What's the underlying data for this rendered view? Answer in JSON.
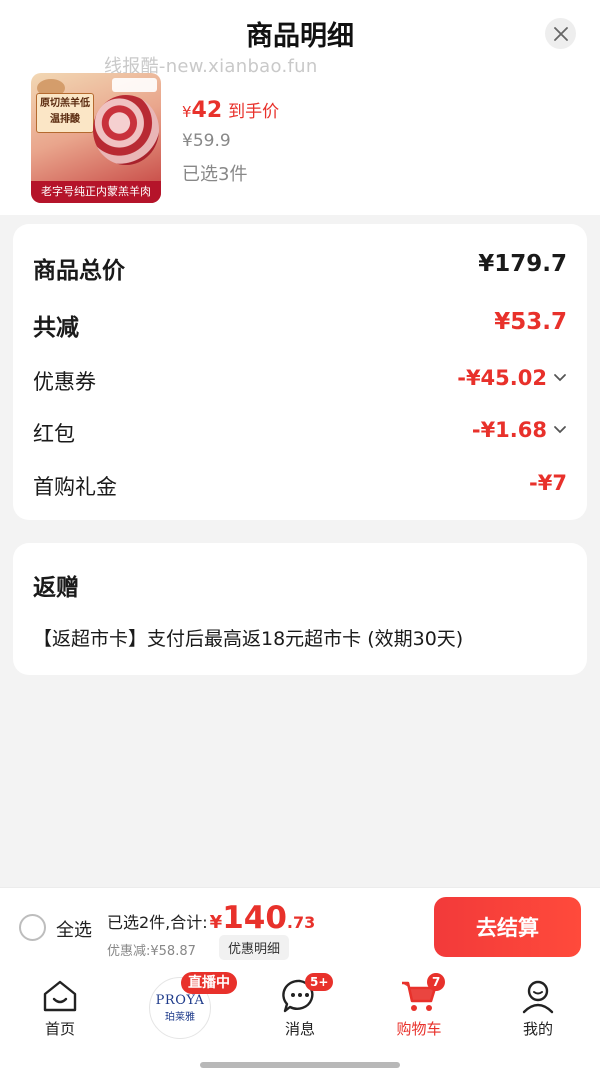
{
  "header": {
    "title": "商品明细",
    "watermark": "线报酷-new.xianbao.fun"
  },
  "product": {
    "badge_text": "原切羔羊低温排酸",
    "caption": "老字号纯正内蒙羔羊肉",
    "currency": "¥",
    "final_price": "42",
    "final_price_label": "到手价",
    "original_price": "¥59.9",
    "selected_count": "已选3件"
  },
  "summary": {
    "total_label": "商品总价",
    "total_value": "¥179.7",
    "reduce_label": "共减",
    "reduce_value": "¥53.7",
    "lines": [
      {
        "label": "优惠券",
        "value": "-¥45.02"
      },
      {
        "label": "红包",
        "value": "-¥1.68"
      },
      {
        "label": "首购礼金",
        "value": "-¥7"
      }
    ]
  },
  "gift": {
    "title": "返赠",
    "text": "【返超市卡】支付后最高返18元超市卡 (效期30天)"
  },
  "checkout_bar": {
    "select_all": "全选",
    "selected_total_prefix": "已选2件,合计:",
    "currency": "¥",
    "total_integer": "140",
    "total_decimal": ".73",
    "discount_text": "优惠减:¥58.87",
    "detail_button": "优惠明细",
    "checkout_button": "去结算"
  },
  "tabbar": {
    "home": "首页",
    "live_badge": "直播中",
    "live_brand": "PROYA",
    "live_brand_sub": "珀莱雅",
    "messages": "消息",
    "messages_badge": "5+",
    "cart": "购物车",
    "cart_badge": "7",
    "me": "我的"
  },
  "colors": {
    "accent": "#e8312b",
    "background": "#f3f3f3"
  }
}
